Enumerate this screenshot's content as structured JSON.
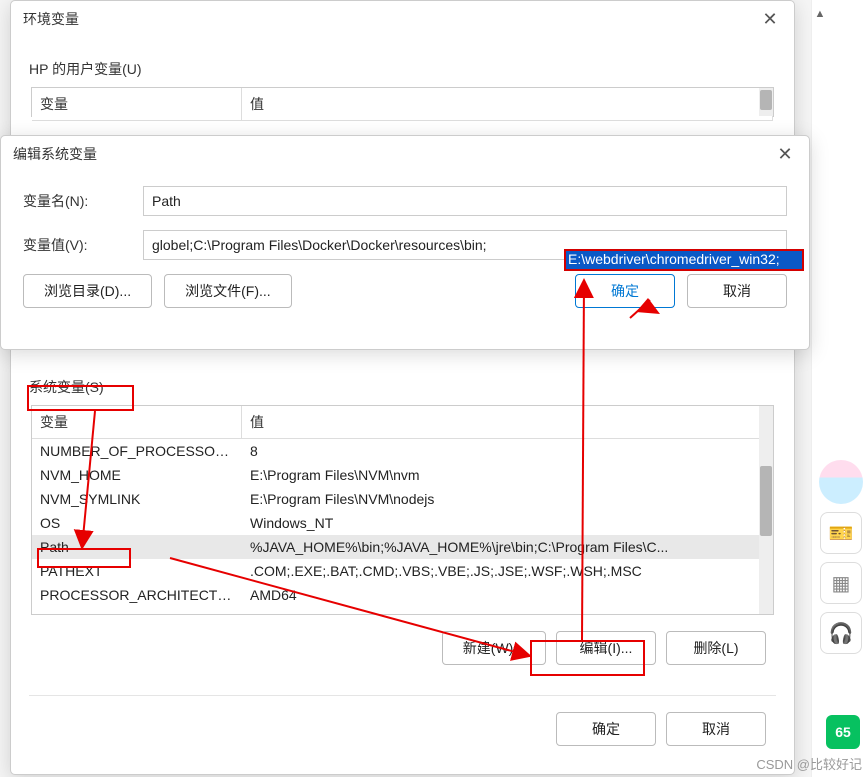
{
  "dlg1": {
    "title": "环境变量",
    "user_group": "HP 的用户变量(U)",
    "sys_group": "系统变量(S)",
    "col_var": "变量",
    "col_val": "值",
    "sys_rows": [
      {
        "k": "NUMBER_OF_PROCESSORS",
        "v": "8"
      },
      {
        "k": "NVM_HOME",
        "v": "E:\\Program Files\\NVM\\nvm"
      },
      {
        "k": "NVM_SYMLINK",
        "v": "E:\\Program Files\\NVM\\nodejs"
      },
      {
        "k": "OS",
        "v": "Windows_NT"
      },
      {
        "k": "Path",
        "v": "%JAVA_HOME%\\bin;%JAVA_HOME%\\jre\\bin;C:\\Program Files\\C..."
      },
      {
        "k": "PATHEXT",
        "v": ".COM;.EXE;.BAT;.CMD;.VBS;.VBE;.JS;.JSE;.WSF;.WSH;.MSC"
      },
      {
        "k": "PROCESSOR_ARCHITECTURE",
        "v": "AMD64"
      }
    ],
    "btn_new": "新建(W)...",
    "btn_edit": "编辑(I)...",
    "btn_del": "删除(L)",
    "btn_ok": "确定",
    "btn_cancel": "取消"
  },
  "dlg2": {
    "title": "编辑系统变量",
    "name_label": "变量名(N):",
    "name_value": "Path",
    "value_label": "变量值(V):",
    "value_display": "globel;C:\\Program Files\\Docker\\Docker\\resources\\bin;",
    "value_selected": "E:\\webdriver\\chromedriver_win32;",
    "btn_browse_dir": "浏览目录(D)...",
    "btn_browse_file": "浏览文件(F)...",
    "btn_ok": "确定",
    "btn_cancel": "取消"
  },
  "side": {
    "badge": "65"
  },
  "watermark": "CSDN @比较好记"
}
